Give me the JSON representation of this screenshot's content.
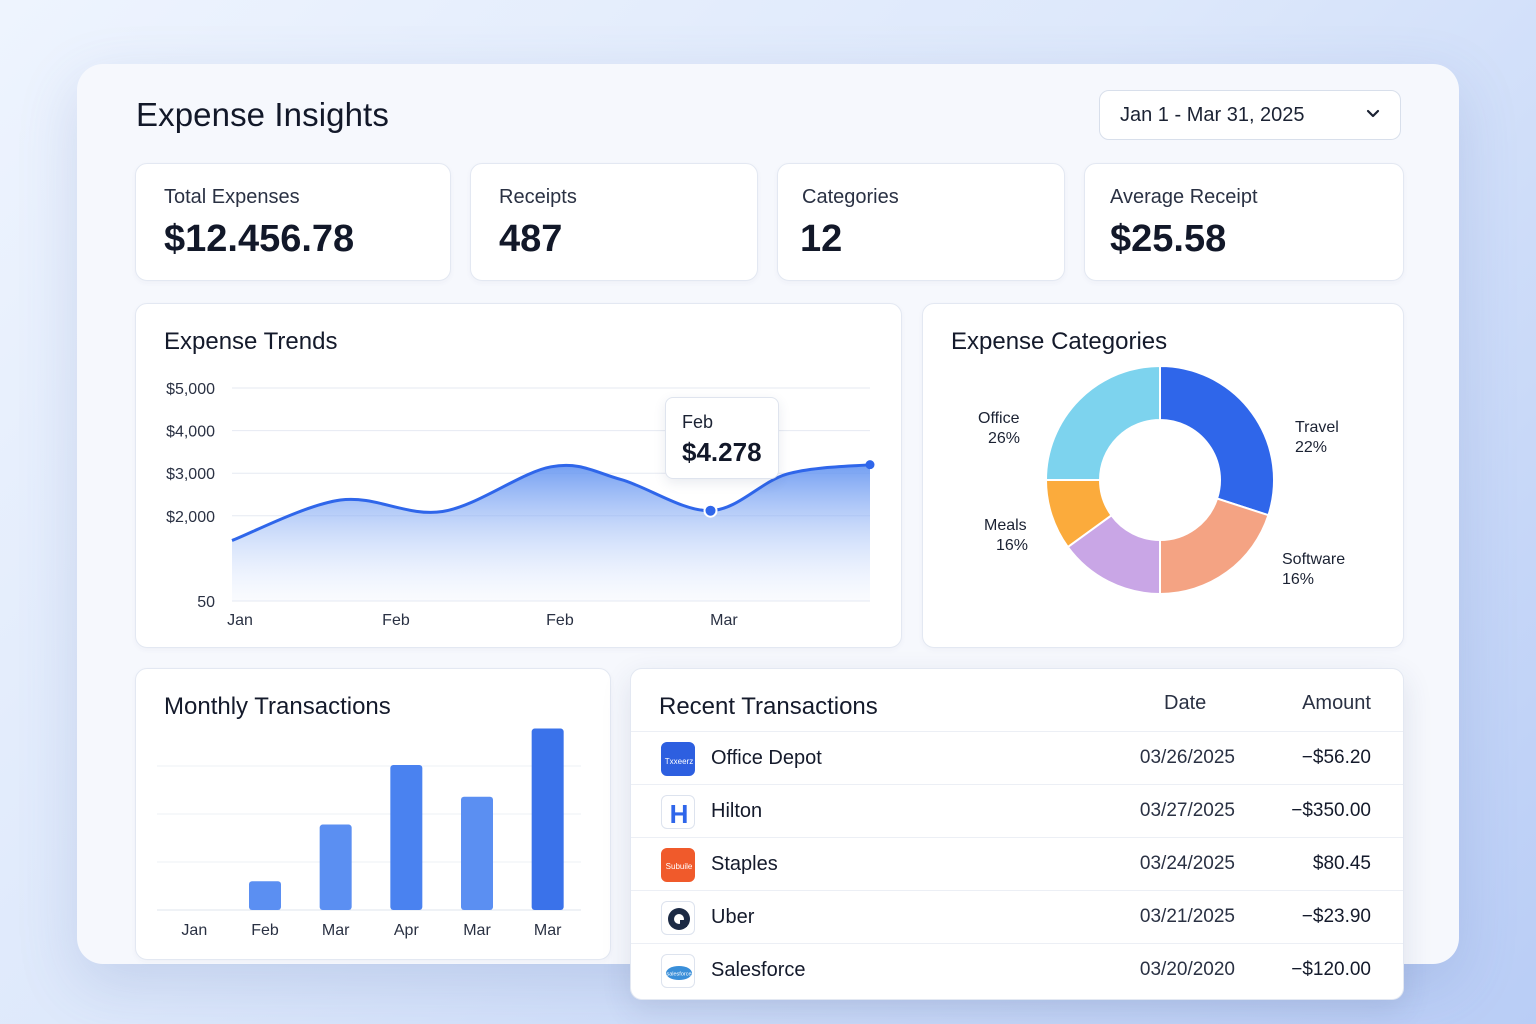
{
  "header": {
    "title": "Expense Insights",
    "date_range": "Jan 1 - Mar 31, 2025"
  },
  "kpis": [
    {
      "label": "Total Expenses",
      "value": "$12.456.78"
    },
    {
      "label": "Receipts",
      "value": "487"
    },
    {
      "label": "Categories",
      "value": "12"
    },
    {
      "label": "Average Receipt",
      "value": "$25.58"
    }
  ],
  "trends": {
    "title": "Expense Trends",
    "tooltip": {
      "label": "Feb",
      "value": "$4.278"
    }
  },
  "categories_card": {
    "title": "Expense Categories",
    "labels": {
      "office": {
        "name": "Office",
        "pct": "26%"
      },
      "travel": {
        "name": "Travel",
        "pct": "22%"
      },
      "meals": {
        "name": "Meals",
        "pct": "16%"
      },
      "software": {
        "name": "Software",
        "pct": "16%"
      }
    }
  },
  "monthly": {
    "title": "Monthly Transactions"
  },
  "transactions": {
    "title": "Recent Transactions",
    "col_date": "Date",
    "col_amount": "Amount",
    "rows": [
      {
        "name": "Office Depot",
        "date": "03/26/2025",
        "amount": "−$56.20",
        "logo_text": "Txxeerz"
      },
      {
        "name": "Hilton",
        "date": "03/27/2025",
        "amount": "−$350.00",
        "logo_text": "H"
      },
      {
        "name": "Staples",
        "date": "03/24/2025",
        "amount": "$80.45",
        "logo_text": "Subuile"
      },
      {
        "name": "Uber",
        "date": "03/21/2025",
        "amount": "−$23.90",
        "logo_text": ""
      },
      {
        "name": "Salesforce",
        "date": "03/20/2020",
        "amount": "−$120.00",
        "logo_text": "salesforce"
      }
    ]
  },
  "colors": {
    "accent": "#2f66ea",
    "office": "#7dd3ee",
    "travel": "#2f66ea",
    "software": "#f4a383",
    "meals_purple": "#c9a6e6",
    "meals_orange": "#fbab3c"
  },
  "chart_data": [
    {
      "type": "area",
      "title": "Expense Trends",
      "x_tick_labels": [
        "Jan",
        "Feb",
        "Feb",
        "Mar"
      ],
      "y_tick_labels": [
        "$5,000",
        "$4,000",
        "$3,000",
        "$2,000",
        "50"
      ],
      "y_ticks": [
        5000,
        4000,
        3000,
        2000,
        0
      ],
      "grid": true,
      "points": [
        {
          "x": 0.0,
          "y": 1420
        },
        {
          "x": 0.17,
          "y": 2370
        },
        {
          "x": 0.33,
          "y": 2100
        },
        {
          "x": 0.5,
          "y": 3150
        },
        {
          "x": 0.61,
          "y": 2850
        },
        {
          "x": 0.75,
          "y": 2120
        },
        {
          "x": 0.87,
          "y": 2980
        },
        {
          "x": 1.0,
          "y": 3200
        }
      ],
      "highlight": {
        "x": 0.75,
        "label": "Feb",
        "value": "$4.278"
      }
    },
    {
      "type": "pie",
      "title": "Expense Categories",
      "slices": [
        {
          "label": "Travel",
          "value": 30,
          "printed": "22%"
        },
        {
          "label": "Software",
          "value": 20,
          "printed": "16%"
        },
        {
          "label": "Meals",
          "value": 15,
          "printed": "16%"
        },
        {
          "label": "Meals",
          "value": 10,
          "printed": ""
        },
        {
          "label": "Office",
          "value": 25,
          "printed": "26%"
        }
      ]
    },
    {
      "type": "bar",
      "title": "Monthly Transactions",
      "categories": [
        "Jan",
        "Feb",
        "Mar",
        "Apr",
        "Mar",
        "Mar"
      ],
      "values": [
        0,
        30,
        89,
        151,
        118,
        189
      ],
      "ylim": [
        0,
        200
      ],
      "grid": true
    }
  ]
}
